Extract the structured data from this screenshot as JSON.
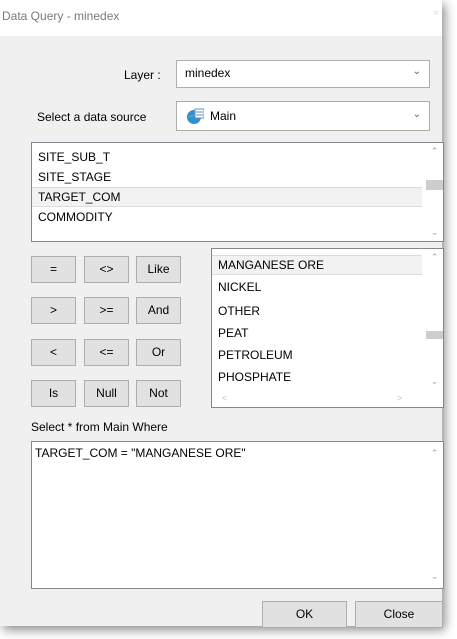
{
  "window": {
    "title": "Data Query - minedex",
    "close_glyph": "×"
  },
  "layer": {
    "label": "Layer :",
    "value": "minedex"
  },
  "data_source": {
    "label": "Select a data source",
    "value": "Main",
    "icon": "database-table-icon"
  },
  "fields": {
    "items": [
      "SITE_SUB_T",
      "SITE_STAGE",
      "TARGET_COM",
      "COMMODITY"
    ],
    "selected_index": 2
  },
  "operators": {
    "eq": "=",
    "ne": "<>",
    "like": "Like",
    "gt": ">",
    "ge": ">=",
    "and": "And",
    "lt": "<",
    "le": "<=",
    "or": "Or",
    "is": "Is",
    "null": "Null",
    "not": "Not"
  },
  "values": {
    "items": [
      "MANGANESE ORE",
      "NICKEL",
      "OTHER",
      "PEAT",
      "PETROLEUM",
      "PHOSPHATE"
    ],
    "selected_index": 0
  },
  "query": {
    "prefix": "Select * from Main Where",
    "text": "TARGET_COM = \"MANGANESE ORE\""
  },
  "buttons": {
    "ok": "OK",
    "close": "Close"
  }
}
